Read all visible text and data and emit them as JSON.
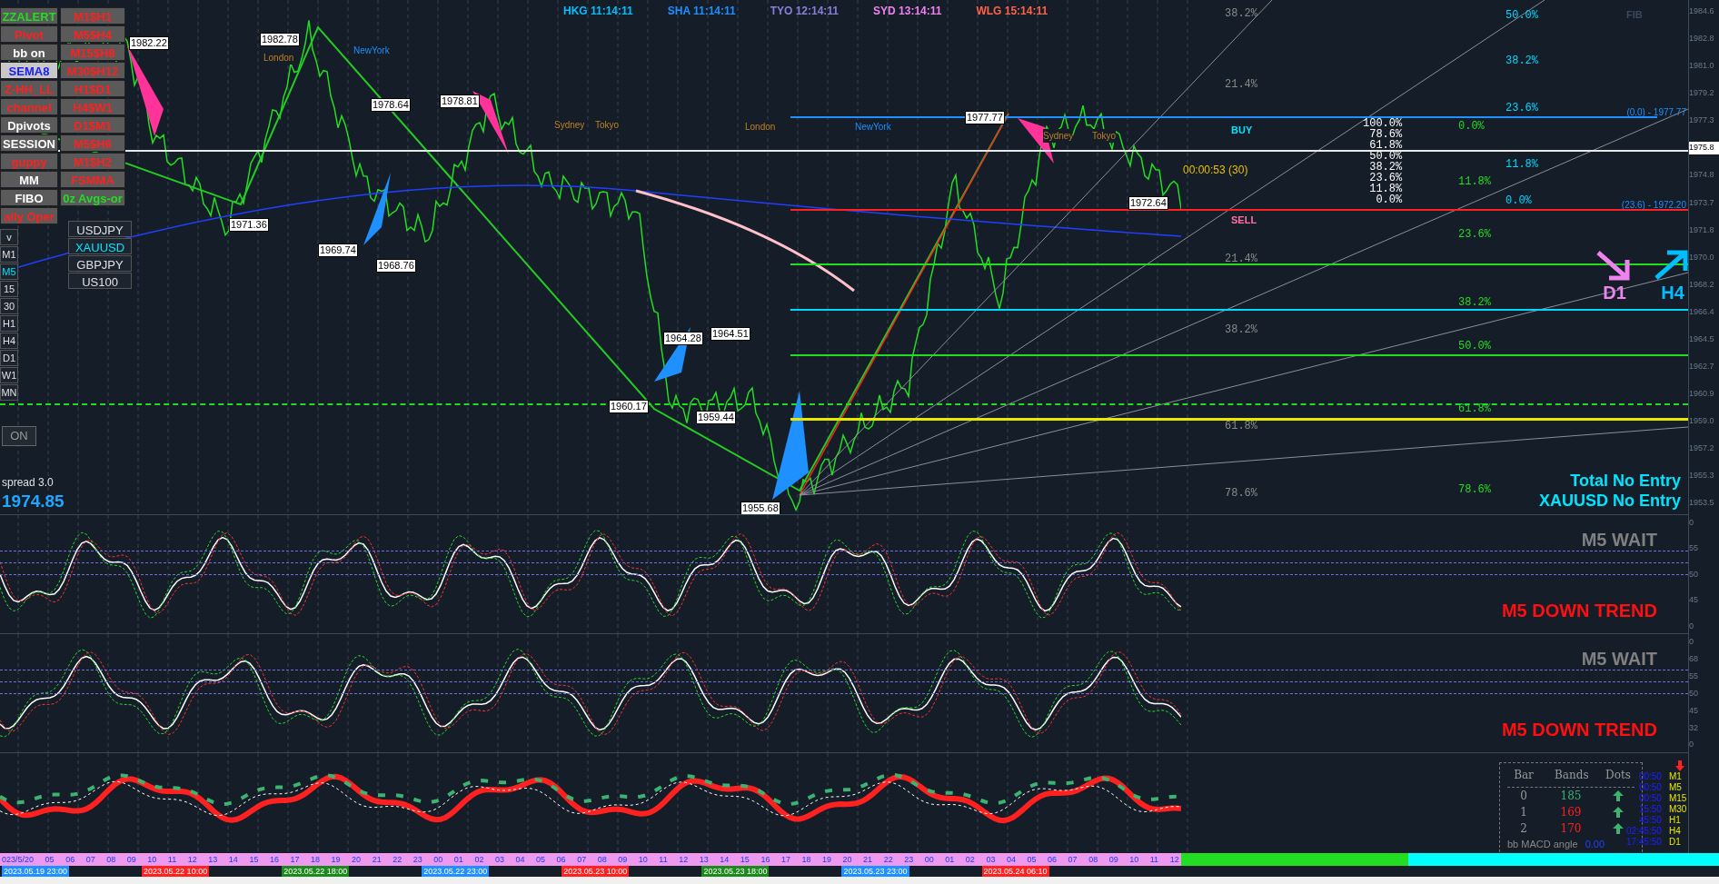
{
  "sessions": [
    {
      "label": "HKG 11:14:11",
      "color": "#00bfff"
    },
    {
      "label": "SHA 11:14:11",
      "color": "#1e90ff"
    },
    {
      "label": "TYO 12:14:11",
      "color": "#8a7fd8"
    },
    {
      "label": "SYD 13:14:11",
      "color": "#ee82ee"
    },
    {
      "label": "WLG 15:14:11",
      "color": "#ff6347"
    }
  ],
  "buttons_left": [
    {
      "label": "ZZALERT",
      "kind": "alert"
    },
    {
      "label": "Pivot",
      "kind": "off"
    },
    {
      "label": "bb on",
      "kind": "on"
    },
    {
      "label": "SEMA8",
      "kind": "highlight"
    },
    {
      "label": "Z-HH_LL",
      "kind": "off"
    },
    {
      "label": "channel",
      "kind": "off"
    },
    {
      "label": "Dpivots",
      "kind": "on"
    },
    {
      "label": "SESSION",
      "kind": "on"
    },
    {
      "label": "guppy",
      "kind": "off"
    },
    {
      "label": "MM",
      "kind": "on"
    },
    {
      "label": "FIBO",
      "kind": "on"
    },
    {
      "label": "aily Oper",
      "kind": "off"
    }
  ],
  "buttons_right": [
    {
      "label": "M1$H1",
      "kind": "off"
    },
    {
      "label": "M5$H4",
      "kind": "off"
    },
    {
      "label": "M15$H8",
      "kind": "off"
    },
    {
      "label": "M30$H12",
      "kind": "off"
    },
    {
      "label": "H1$D1",
      "kind": "off"
    },
    {
      "label": "H4$W1",
      "kind": "off"
    },
    {
      "label": "D1$M1",
      "kind": "off"
    },
    {
      "label": "M5$H6",
      "kind": "off"
    },
    {
      "label": "M1$H2",
      "kind": "off"
    },
    {
      "label": "FSMMA",
      "kind": "off"
    },
    {
      "label": "0z Avgs-or",
      "kind": "alert"
    }
  ],
  "timeframes": [
    {
      "label": "v",
      "selected": false
    },
    {
      "label": "M1",
      "selected": false
    },
    {
      "label": "M5",
      "selected": true
    },
    {
      "label": "15",
      "selected": false
    },
    {
      "label": "30",
      "selected": false
    },
    {
      "label": "H1",
      "selected": false
    },
    {
      "label": "H4",
      "selected": false
    },
    {
      "label": "D1",
      "selected": false
    },
    {
      "label": "W1",
      "selected": false
    },
    {
      "label": "MN",
      "selected": false
    }
  ],
  "symbols": [
    {
      "label": "USDJPY",
      "selected": false
    },
    {
      "label": "XAUUSD",
      "selected": true
    },
    {
      "label": "GBPJPY",
      "selected": false
    },
    {
      "label": "US100",
      "selected": false
    }
  ],
  "on_button": "ON",
  "spread": "spread 3.0",
  "bid": "1974.85",
  "price_tags": [
    "1982.22",
    "1982.78",
    "1978.64",
    "1978.81",
    "1971.36",
    "1969.74",
    "1968.76",
    "1964.28",
    "1964.51",
    "1960.17",
    "1959.44",
    "1955.68",
    "1977.77",
    "1972.64"
  ],
  "session_marks": [
    "London",
    "NewYork",
    "Sydney",
    "Tokyo",
    "London",
    "NewYork",
    "Sydney",
    "Tokyo"
  ],
  "fib_white": [
    "100.0%",
    "78.6%",
    "61.8%",
    "50.0%",
    "38.2%",
    "23.6%",
    "11.8%",
    "0.0%"
  ],
  "fib_grey": [
    "38.2%",
    "21.4%",
    "21.4%",
    "38.2%",
    "61.8%",
    "78.6%"
  ],
  "fib_green": [
    "0.0%",
    "11.8%",
    "23.6%",
    "38.2%",
    "50.0%",
    "61.8%",
    "78.6%"
  ],
  "fib_cyan": [
    "50.0%",
    "38.2%",
    "23.6%",
    "11.8%",
    "0.0%"
  ],
  "fib_tag": "FIB",
  "fib_levels": [
    "(0.0) - 1977.77",
    "(23.6) - 1972.20"
  ],
  "buy": "BUY",
  "sell": "SELL",
  "countdown": "00:00:53 (30)",
  "trend_labels": [
    {
      "label": "D1",
      "color": "#ee82ee"
    },
    {
      "label": "H4",
      "color": "#00bfff"
    }
  ],
  "entry_status": [
    "Total No Entry",
    "XAUUSD No Entry"
  ],
  "panels": [
    {
      "top": "M5 WAIT",
      "bottom": "M5 DOWN TREND",
      "levels": [
        "0",
        "55",
        "50",
        "45",
        "0"
      ]
    },
    {
      "top": "M5 WAIT",
      "bottom": "M5 DOWN TREND",
      "levels": [
        "0",
        "68",
        "55",
        "50",
        "45",
        "32",
        "0"
      ]
    }
  ],
  "price_axis": [
    "1984.6",
    "1982.8",
    "1981.0",
    "1979.2",
    "1977.3",
    "1975.8",
    "1974.8",
    "1973.7",
    "1971.8",
    "1970.0",
    "1968.2",
    "1966.4",
    "1964.5",
    "1962.7",
    "1960.9",
    "1959.0",
    "1957.2",
    "1955.3",
    "1953.5"
  ],
  "table": {
    "columns": [
      "Bar",
      "Bands",
      "Dots"
    ],
    "rows": [
      {
        "bar": "0",
        "bands": "185",
        "kind": "positive"
      },
      {
        "bar": "1",
        "bands": "169",
        "kind": "negative"
      },
      {
        "bar": "2",
        "bands": "170",
        "kind": "negative"
      }
    ]
  },
  "macd_label": "bb MACD angle",
  "macd_value": "0.00",
  "timers": [
    {
      "time": "00:50",
      "tf": "M1"
    },
    {
      "time": "00:50",
      "tf": "M5"
    },
    {
      "time": "00:50",
      "tf": "M15"
    },
    {
      "time": "15:50",
      "tf": "M30"
    },
    {
      "time": "45:50",
      "tf": "H1"
    },
    {
      "time": "02:45:50",
      "tf": "H4"
    },
    {
      "time": "17:45:50",
      "tf": "D1"
    }
  ],
  "hours": [
    "023/5/20",
    "05",
    "06",
    "07",
    "08",
    "09",
    "10",
    "11",
    "12",
    "13",
    "14",
    "15",
    "16",
    "17",
    "18",
    "19",
    "20",
    "21",
    "22",
    "23",
    "00",
    "01",
    "02",
    "03",
    "04",
    "05",
    "06",
    "07",
    "08",
    "09",
    "10",
    "11",
    "12",
    "13",
    "14",
    "15",
    "16",
    "17",
    "18",
    "19",
    "20",
    "21",
    "22",
    "23",
    "00",
    "01",
    "02",
    "03",
    "04",
    "05",
    "06",
    "07",
    "08",
    "09",
    "10",
    "11",
    "12"
  ],
  "dates": [
    {
      "label": "2023.05.19 23:00",
      "color": "#1e90ff"
    },
    {
      "label": "2023.05.22 10:00",
      "color": "#ff2020"
    },
    {
      "label": "2023.05.22 18:00",
      "color": "#1a8a1a"
    },
    {
      "label": "2023.05.22 23:00",
      "color": "#1e90ff"
    },
    {
      "label": "2023.05.23 10:00",
      "color": "#ff2020"
    },
    {
      "label": "2023.05.23 18:00",
      "color": "#1a8a1a"
    },
    {
      "label": "2023.05.23 23:00",
      "color": "#1e90ff"
    },
    {
      "label": "2023.05.24 06:10",
      "color": "#ff2020"
    }
  ]
}
